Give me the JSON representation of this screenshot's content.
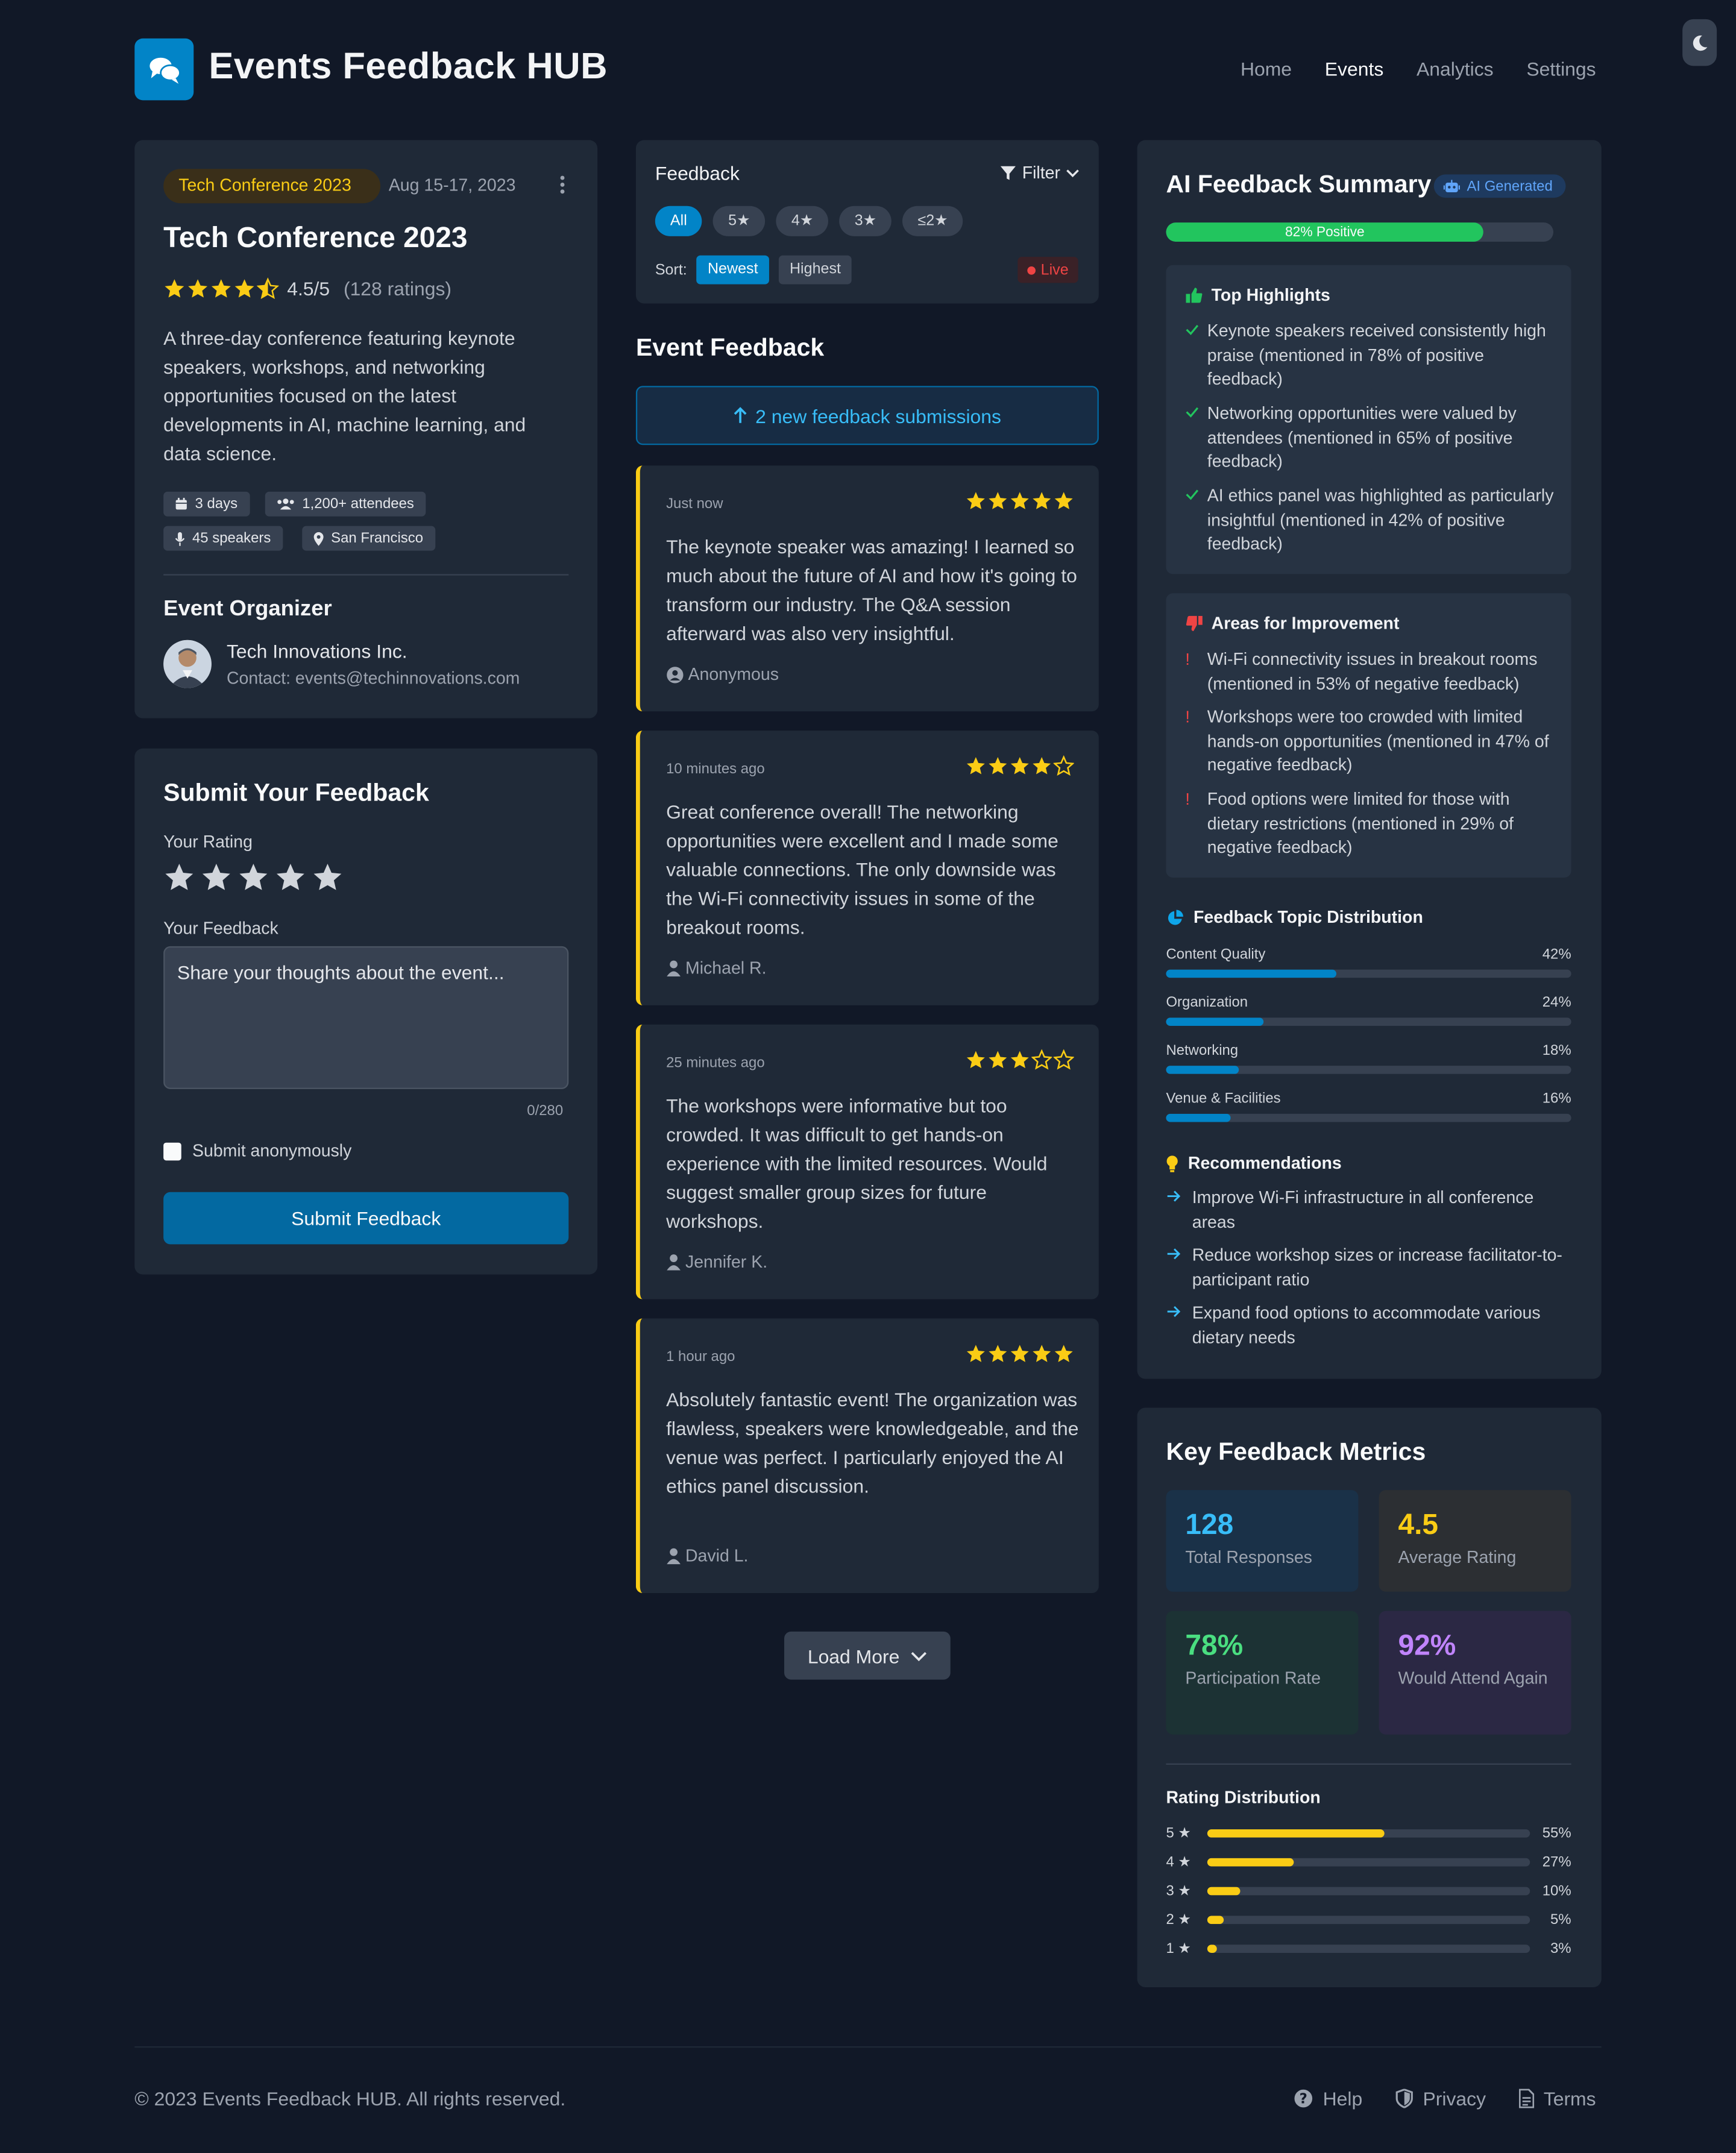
{
  "app": {
    "title": "Events Feedback HUB"
  },
  "nav": {
    "items": [
      "Home",
      "Events",
      "Analytics",
      "Settings"
    ],
    "active": "Events"
  },
  "event": {
    "tag": "Tech Conference 2023",
    "date": "Aug 15-17, 2023",
    "title": "Tech Conference 2023",
    "rating": "4.5/5",
    "rating_count": "(128 ratings)",
    "description": "A three-day conference featuring keynote speakers, workshops, and networking opportunities focused on the latest developments in AI, machine learning, and data science.",
    "chips": {
      "duration": "3 days",
      "attendees": "1,200+ attendees",
      "speakers": "45 speakers",
      "location": "San Francisco"
    },
    "organizer_heading": "Event Organizer",
    "organizer_name": "Tech Innovations Inc.",
    "organizer_contact": "Contact: events@techinnovations.com"
  },
  "submit": {
    "title": "Submit Your Feedback",
    "rating_label": "Your Rating",
    "feedback_label": "Your Feedback",
    "placeholder": "Share your thoughts about the event...",
    "char_count": "0/280",
    "anonymous_label": "Submit anonymously",
    "button": "Submit Feedback"
  },
  "filter": {
    "title": "Feedback",
    "filter_label": "Filter",
    "pills": [
      "All",
      "5★",
      "4★",
      "3★",
      "≤2★"
    ],
    "sort_label": "Sort:",
    "sort_options": [
      "Newest",
      "Highest"
    ],
    "live": "Live"
  },
  "feed": {
    "heading": "Event Feedback",
    "new_banner": "2 new feedback submissions",
    "items": [
      {
        "time": "Just now",
        "stars": 5,
        "text": "The keynote speaker was amazing! I learned so much about the future of AI and how it's going to transform our industry. The Q&A session afterward was also very insightful.",
        "author": "Anonymous"
      },
      {
        "time": "10 minutes ago",
        "stars": 4,
        "text": "Great conference overall! The networking opportunities were excellent and I made some valuable connections. The only downside was the Wi-Fi connectivity issues in some of the breakout rooms.",
        "author": "Michael R."
      },
      {
        "time": "25 minutes ago",
        "stars": 3,
        "text": "The workshops were informative but too crowded. It was difficult to get hands-on experience with the limited resources. Would suggest smaller group sizes for future workshops.",
        "author": "Jennifer K."
      },
      {
        "time": "1 hour ago",
        "stars": 5,
        "text": "Absolutely fantastic event! The organization was flawless, speakers were knowledgeable, and the venue was perfect. I particularly enjoyed the AI ethics panel discussion.",
        "author": "David L."
      }
    ],
    "load_more": "Load More"
  },
  "ai": {
    "title": "AI Feedback Summary",
    "badge": "AI Generated",
    "sentiment": {
      "label": "82% Positive",
      "value": 82
    },
    "highlights_heading": "Top Highlights",
    "highlights": [
      "Keynote speakers received consistently high praise (mentioned in 78% of positive feedback)",
      "Networking opportunities were valued by attendees (mentioned in 65% of positive feedback)",
      "AI ethics panel was highlighted as particularly insightful (mentioned in 42% of positive feedback)"
    ],
    "improvement_heading": "Areas for Improvement",
    "improvements": [
      "Wi-Fi connectivity issues in breakout rooms (mentioned in 53% of negative feedback)",
      "Workshops were too crowded with limited hands-on opportunities (mentioned in 47% of negative feedback)",
      "Food options were limited for those with dietary restrictions (mentioned in 29% of negative feedback)"
    ],
    "topics_heading": "Feedback Topic Distribution",
    "topics": [
      {
        "name": "Content Quality",
        "pct": "42%",
        "value": 42
      },
      {
        "name": "Organization",
        "pct": "24%",
        "value": 24
      },
      {
        "name": "Networking",
        "pct": "18%",
        "value": 18
      },
      {
        "name": "Venue & Facilities",
        "pct": "16%",
        "value": 16
      }
    ],
    "rec_heading": "Recommendations",
    "recommendations": [
      "Improve Wi-Fi infrastructure in all conference areas",
      "Reduce workshop sizes or increase facilitator-to-participant ratio",
      "Expand food options to accommodate various dietary needs"
    ]
  },
  "metrics": {
    "title": "Key Feedback Metrics",
    "cards": [
      {
        "value": "128",
        "label": "Total Responses",
        "color": "#38bdf8"
      },
      {
        "value": "4.5",
        "label": "Average Rating",
        "color": "#facc15"
      },
      {
        "value": "78%",
        "label": "Participation Rate",
        "color": "#4ade80"
      },
      {
        "value": "92%",
        "label": "Would Attend Again",
        "color": "#c084fc"
      }
    ],
    "distribution_heading": "Rating Distribution",
    "distribution": [
      {
        "label": "5 ★",
        "pct": "55%",
        "value": 55
      },
      {
        "label": "4 ★",
        "pct": "27%",
        "value": 27
      },
      {
        "label": "3 ★",
        "pct": "10%",
        "value": 10
      },
      {
        "label": "2 ★",
        "pct": "5%",
        "value": 5
      },
      {
        "label": "1 ★",
        "pct": "3%",
        "value": 3
      }
    ]
  },
  "footer": {
    "copyright": "© 2023 Events Feedback HUB. All rights reserved.",
    "links": [
      "Help",
      "Privacy",
      "Terms"
    ]
  },
  "colors": {
    "accent": "#0284c7",
    "star": "#facc15",
    "positive": "#22c55e",
    "negative": "#ef4444",
    "background": "#111827",
    "card": "#1f2937"
  }
}
